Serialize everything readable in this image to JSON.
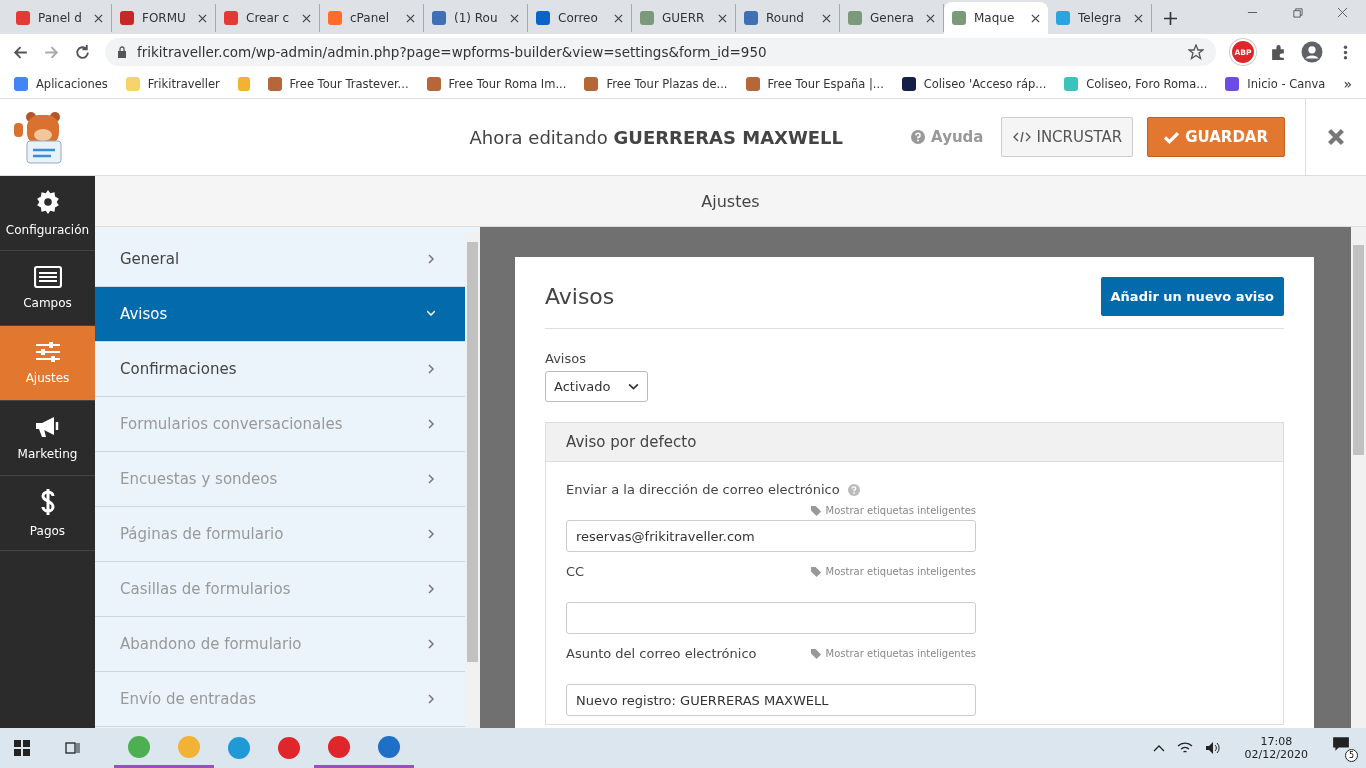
{
  "browser": {
    "tabs": [
      {
        "title": "Panel d",
        "color": "#e53935",
        "selected": false
      },
      {
        "title": "FORMU",
        "color": "#c62828",
        "selected": false
      },
      {
        "title": "Crear c",
        "color": "#e53935",
        "selected": false
      },
      {
        "title": "cPanel",
        "color": "#ff6c2c",
        "selected": false
      },
      {
        "title": "(1) Rou",
        "color": "#3f6fb5",
        "selected": false
      },
      {
        "title": "Correo",
        "color": "#0a64c8",
        "selected": false
      },
      {
        "title": "GUERR",
        "color": "#7a9a7a",
        "selected": false
      },
      {
        "title": "Round",
        "color": "#3f6fb5",
        "selected": false
      },
      {
        "title": "Genera",
        "color": "#7a9a7a",
        "selected": false
      },
      {
        "title": "Maque",
        "color": "#7a9a7a",
        "selected": true
      },
      {
        "title": "Telegra",
        "color": "#2aa3e0",
        "selected": false
      }
    ],
    "url": "frikitraveller.com/wp-admin/admin.php?page=wpforms-builder&view=settings&form_id=950",
    "extension_badge": "ABP",
    "bookmarks": [
      {
        "label": "Aplicaciones",
        "color": "#4285f4"
      },
      {
        "label": "Frikitraveller",
        "color": "#f6d36b"
      },
      {
        "color": "#f2b233"
      },
      {
        "label": "Free Tour Trastever...",
        "color": "#b5673a"
      },
      {
        "label": "Free Tour Roma Im...",
        "color": "#b5673a"
      },
      {
        "label": "Free Tour Plazas de...",
        "color": "#b5673a"
      },
      {
        "label": "Free Tour España |...",
        "color": "#b5673a"
      },
      {
        "label": "Coliseo 'Acceso ráp...",
        "color": "#142048"
      },
      {
        "label": "Coliseo, Foro Roma...",
        "color": "#3cc2bd"
      },
      {
        "label": "Inicio - Canva",
        "color": "#6b4de6"
      }
    ],
    "bookmarks_more": "»"
  },
  "header": {
    "editing": "Ahora editando **GUERRERAS MAXWELL**",
    "help": "Ayuda",
    "embed": "INCRUSTAR",
    "save": "GUARDAR"
  },
  "sidebar": {
    "items": [
      {
        "label": "Configuración",
        "kind": "gear",
        "selected": false
      },
      {
        "label": "Campos",
        "kind": "list",
        "selected": false
      },
      {
        "label": "Ajustes",
        "kind": "sliders",
        "selected": true
      },
      {
        "label": "Marketing",
        "kind": "megaphone",
        "selected": false
      },
      {
        "label": "Pagos",
        "kind": "dollar",
        "selected": false
      }
    ]
  },
  "panel_title": "Ajustes",
  "settings_menu": [
    {
      "label": "General",
      "selected": false,
      "disabled": false
    },
    {
      "label": "Avisos",
      "selected": true,
      "disabled": false
    },
    {
      "label": "Confirmaciones",
      "selected": false,
      "disabled": false
    },
    {
      "label": "Formularios conversacionales",
      "selected": false,
      "disabled": true
    },
    {
      "label": "Encuestas y sondeos",
      "selected": false,
      "disabled": true
    },
    {
      "label": "Páginas de formulario",
      "selected": false,
      "disabled": true
    },
    {
      "label": "Casillas de formularios",
      "selected": false,
      "disabled": true
    },
    {
      "label": "Abandono de formulario",
      "selected": false,
      "disabled": true
    },
    {
      "label": "Envío de entradas",
      "selected": false,
      "disabled": true
    }
  ],
  "notifications": {
    "title": "Avisos",
    "add_button": "Añadir un nuevo aviso",
    "toggle_label": "Avisos",
    "toggle_value": "Activado",
    "notice": {
      "title": "Aviso por defecto",
      "fields": [
        {
          "label": "Enviar a la dirección de correo electrónico",
          "help": true,
          "smart_tags": "Mostrar etiquetas inteligentes",
          "value": "reservas@frikitraveller.com"
        },
        {
          "label": "CC",
          "help": false,
          "smart_tags": "Mostrar etiquetas inteligentes"
        },
        {
          "label": "Asunto del correo electrónico",
          "help": false,
          "smart_tags": "Mostrar etiquetas inteligentes",
          "value": "Nuevo registro: GUERRERAS MAXWELL"
        }
      ]
    }
  },
  "taskbar": {
    "apps": [
      {
        "color": "#4caf50",
        "selected": true
      },
      {
        "color": "#f2b233",
        "selected": true
      },
      {
        "color": "#1f9ad6",
        "selected": false
      },
      {
        "color": "#e0262b",
        "selected": false
      },
      {
        "color": "#e0262b",
        "selected": true
      },
      {
        "color": "#1f6fc8",
        "selected": true
      }
    ],
    "time": "17:08",
    "date": "02/12/2020",
    "notifications": "5"
  }
}
